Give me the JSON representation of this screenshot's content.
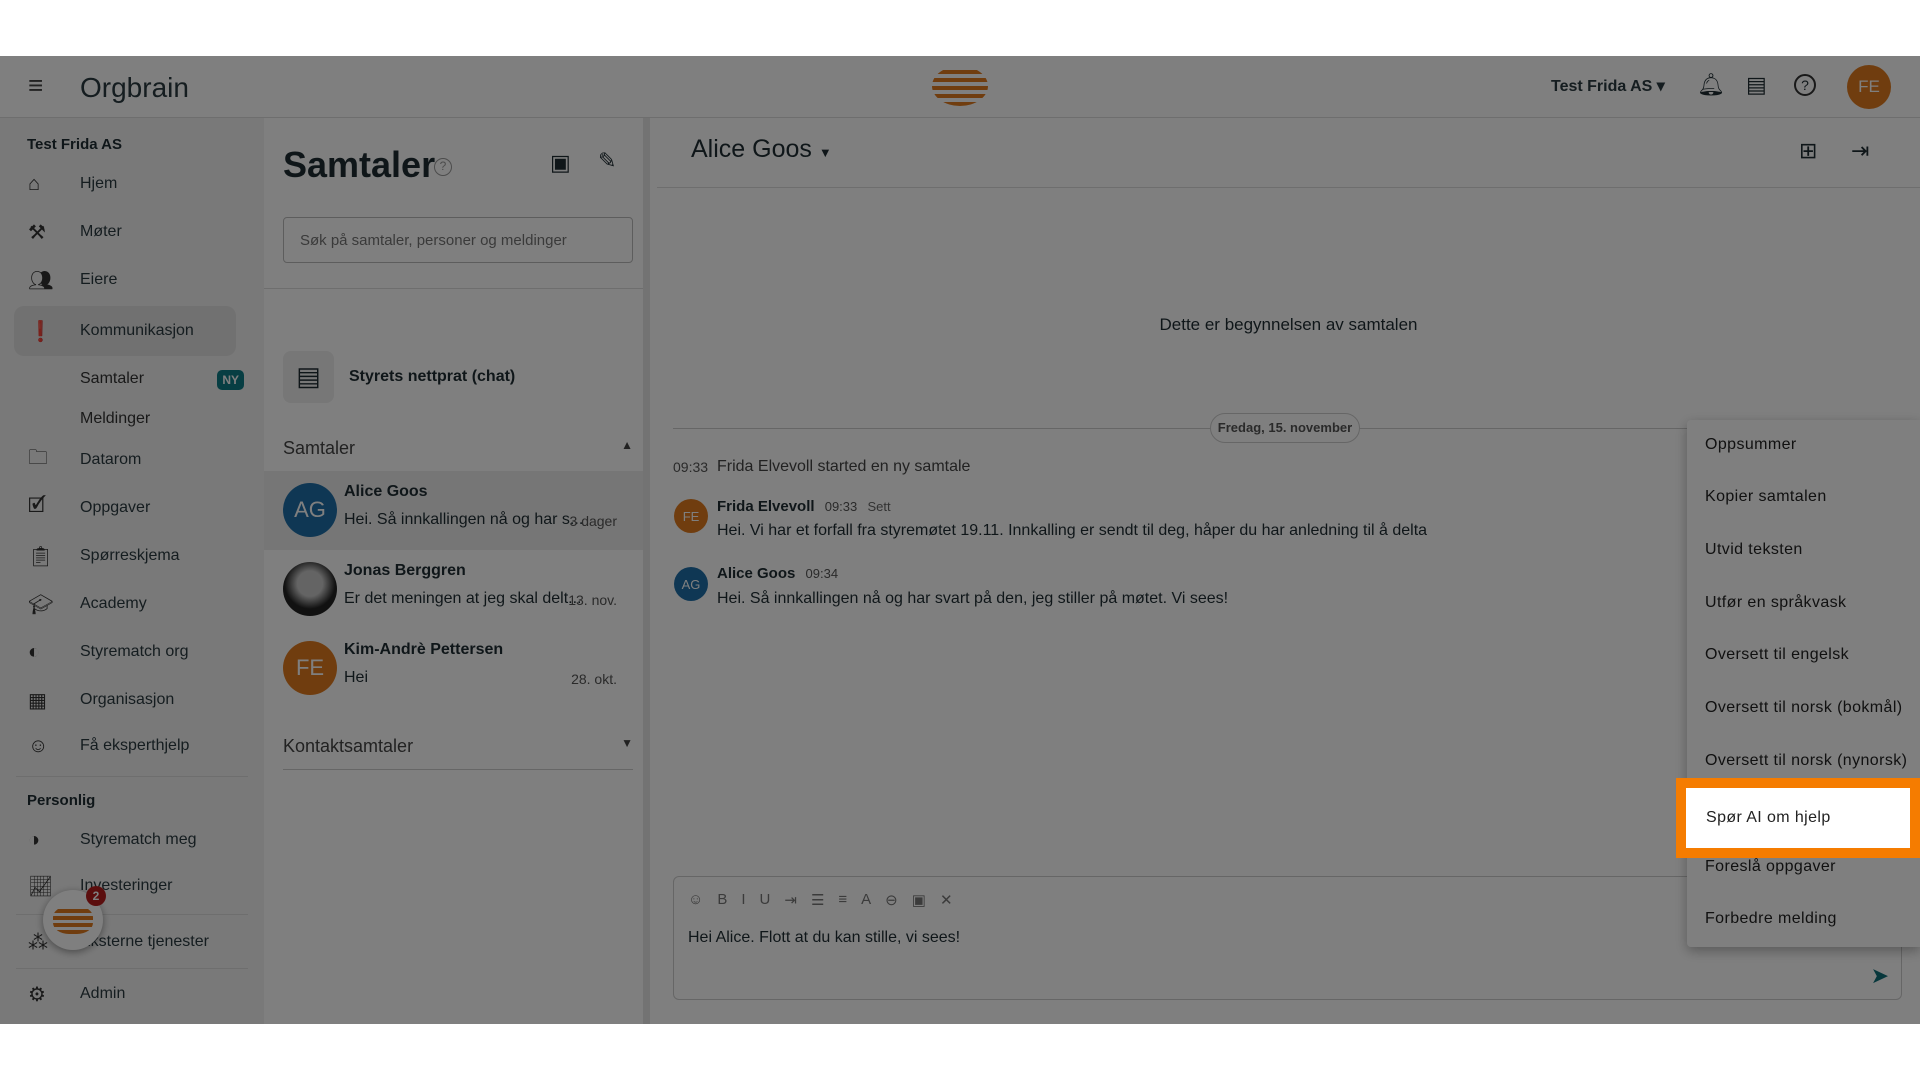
{
  "header": {
    "logo": "Orgbrain",
    "org_selector": "Test Frida AS",
    "avatar": "FE",
    "accent": "#e07b1f"
  },
  "sidebar": {
    "org": "Test Frida AS",
    "items": [
      {
        "label": "Hjem",
        "icon": "home-icon"
      },
      {
        "label": "Møter",
        "icon": "gavel-icon"
      },
      {
        "label": "Eiere",
        "icon": "people-icon"
      },
      {
        "label": "Kommunikasjon",
        "icon": "alert-chat-icon"
      },
      {
        "label": "Datarom",
        "icon": "folder-icon"
      },
      {
        "label": "Oppgaver",
        "icon": "task-icon"
      },
      {
        "label": "Spørreskjema",
        "icon": "survey-icon"
      },
      {
        "label": "Academy",
        "icon": "school-icon"
      },
      {
        "label": "Styrematch org",
        "icon": "match-icon"
      },
      {
        "label": "Organisasjon",
        "icon": "building-icon"
      },
      {
        "label": "Få eksperthjelp",
        "icon": "expert-icon"
      }
    ],
    "subitems": [
      {
        "label": "Samtaler",
        "badge": "NY"
      },
      {
        "label": "Meldinger"
      }
    ],
    "personal_title": "Personlig",
    "personal": [
      {
        "label": "Styrematch meg"
      },
      {
        "label": "Investeringer"
      },
      {
        "label": "Eksterne tjenester"
      },
      {
        "label": "Admin"
      }
    ],
    "fab_badge": "2"
  },
  "conversations": {
    "title": "Samtaler",
    "search_placeholder": "Søk på samtaler, personer og meldinger",
    "board_chat": "Styrets nettprat (chat)",
    "section": "Samtaler",
    "contacts_section": "Kontaktsamtaler",
    "list": [
      {
        "initials": "AG",
        "name": "Alice Goos",
        "preview": "Hei. Så innkallingen nå og har s...",
        "time": "3 dager",
        "color": "#1f6fa8"
      },
      {
        "initials": "",
        "name": "Jonas Berggren",
        "preview": "Er det meningen at jeg skal delt...",
        "time": "13. nov.",
        "color": "#444"
      },
      {
        "initials": "FE",
        "name": "Kim-Andrè Pettersen",
        "preview": "Hei",
        "time": "28. okt.",
        "color": "#e07b1f"
      }
    ]
  },
  "chat": {
    "title": "Alice Goos",
    "start_text": "Dette er begynnelsen av samtalen",
    "date": "Fredag, 15. november",
    "system": {
      "time": "09:33",
      "text": "Frida Elvevoll started en ny samtale"
    },
    "messages": [
      {
        "initials": "FE",
        "name": "Frida Elvevoll",
        "time": "09:33",
        "status": "Sett",
        "text": "Hei. Vi har et forfall fra styremøtet 19.11. Innkalling er sendt til deg, håper du har anledning til å delta",
        "color": "#e07b1f"
      },
      {
        "initials": "AG",
        "name": "Alice Goos",
        "time": "09:34",
        "status": "",
        "text": "Hei. Så innkallingen nå og har svart på den, jeg stiller på møtet. Vi sees!",
        "color": "#1f6fa8"
      }
    ],
    "composer_value": "Hei Alice. Flott at du kan stille, vi sees!",
    "toolbar": [
      "☺",
      "B",
      "I",
      "U",
      "⇥",
      "☰",
      "≡",
      "A",
      "⊖",
      "▣",
      "✕"
    ]
  },
  "ai_menu": {
    "items": [
      "Oppsummer",
      "Kopier samtalen",
      "Utvid teksten",
      "Utfør en språkvask",
      "Oversett til engelsk",
      "Oversett til norsk (bokmål)",
      "Oversett til norsk (nynorsk)",
      "Spør AI om hjelp",
      "Foreslå oppgaver",
      "Forbedre melding"
    ],
    "highlighted": "Spør AI om hjelp",
    "highlight_color": "#f57c00"
  }
}
